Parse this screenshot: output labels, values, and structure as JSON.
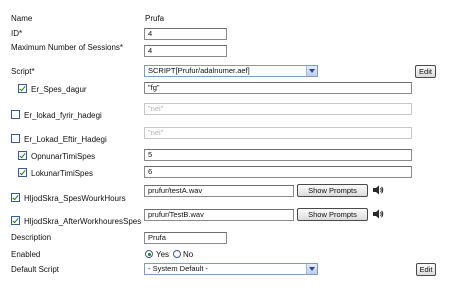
{
  "form": {
    "name": {
      "label": "Name",
      "value": "Prufa"
    },
    "id": {
      "label": "ID*",
      "value": "4"
    },
    "max_sessions": {
      "label": "Maximum Number of Sessions*",
      "value": "4"
    },
    "script": {
      "label": "Script*",
      "selected": "SCRIPT[Prufur/adalnumer.aef]",
      "edit_label": "Edit"
    },
    "er_spes_dagur": {
      "label": "Er_Spes_dagur",
      "checked": true,
      "value": "\"fg\""
    },
    "er_lokad_fyrir_hadegi": {
      "label": "Er_lokad_fyrir_hadegi",
      "checked": false,
      "value": "\"nei\""
    },
    "er_lokad_eftir_hadegi": {
      "label": "Er_Lokad_Eftir_Hadegi",
      "checked": false,
      "value": "\"nei\""
    },
    "opnunar_timi_spes": {
      "label": "OpnunarTimiSpes",
      "checked": true,
      "value": "5"
    },
    "lokunar_timi_spes": {
      "label": "LokunarTimiSpes",
      "checked": true,
      "value": "6"
    },
    "hljod_spes_wourk": {
      "label": "HljodSkra_SpesWourkHours",
      "checked": true,
      "value": "prufur/testA.wav",
      "button_label": "Show Prompts"
    },
    "hljod_after_work": {
      "label": "HljodSkra_AfterWorkhouresSpes",
      "checked": true,
      "value": "prufur/TestB.wav",
      "button_label": "Show Prompts"
    },
    "description": {
      "label": "Description",
      "value": "Prufa"
    },
    "enabled": {
      "label": "Enabled",
      "yes_label": "Yes",
      "no_label": "No",
      "selected": "Yes"
    },
    "default_script": {
      "label": "Default Script",
      "selected": "- System Default -",
      "edit_label": "Edit"
    }
  },
  "icons": {
    "speaker_a": "speaker-icon",
    "speaker_b": "speaker-icon"
  },
  "colors": {
    "checkmark": "#1f7a1f",
    "select_border": "#7f9db9",
    "disabled_text": "#b0b0b0"
  }
}
